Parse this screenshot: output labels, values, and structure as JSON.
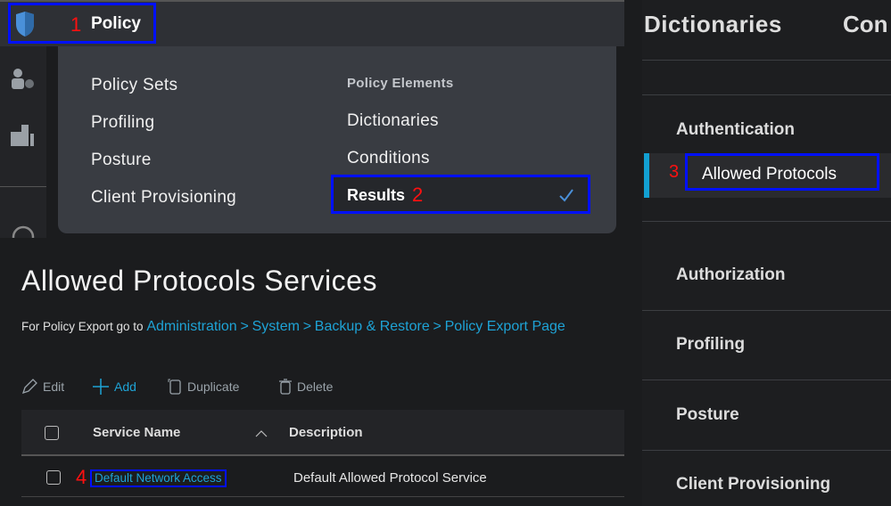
{
  "header": {
    "policy_label": "Policy",
    "step1": "1"
  },
  "menu": {
    "left_items": [
      "Policy Sets",
      "Profiling",
      "Posture",
      "Client Provisioning"
    ],
    "right_heading": "Policy Elements",
    "right_items": [
      "Dictionaries",
      "Conditions"
    ],
    "selected": "Results",
    "step2": "2"
  },
  "page": {
    "title": "Allowed Protocols Services",
    "export_prefix": "For Policy Export go to",
    "export_path": [
      "Administration",
      "System",
      "Backup & Restore",
      "Policy Export Page"
    ],
    "separator": ">"
  },
  "toolbar": {
    "edit": "Edit",
    "add": "Add",
    "duplicate": "Duplicate",
    "delete": "Delete"
  },
  "table": {
    "columns": [
      "Service Name",
      "Description"
    ],
    "rows": [
      {
        "name": "Default Network Access",
        "description": "Default Allowed Protocol Service"
      }
    ],
    "step4": "4"
  },
  "right_panel": {
    "tabs": [
      "Dictionaries",
      "Con"
    ],
    "sections": [
      "Authentication",
      "Authorization",
      "Profiling",
      "Posture",
      "Client Provisioning"
    ],
    "selected_item": "Allowed Protocols",
    "step3": "3"
  },
  "colors": {
    "accent": "#1ea3d6",
    "highlight_box": "#0010ff",
    "step_number": "#ff1010"
  }
}
